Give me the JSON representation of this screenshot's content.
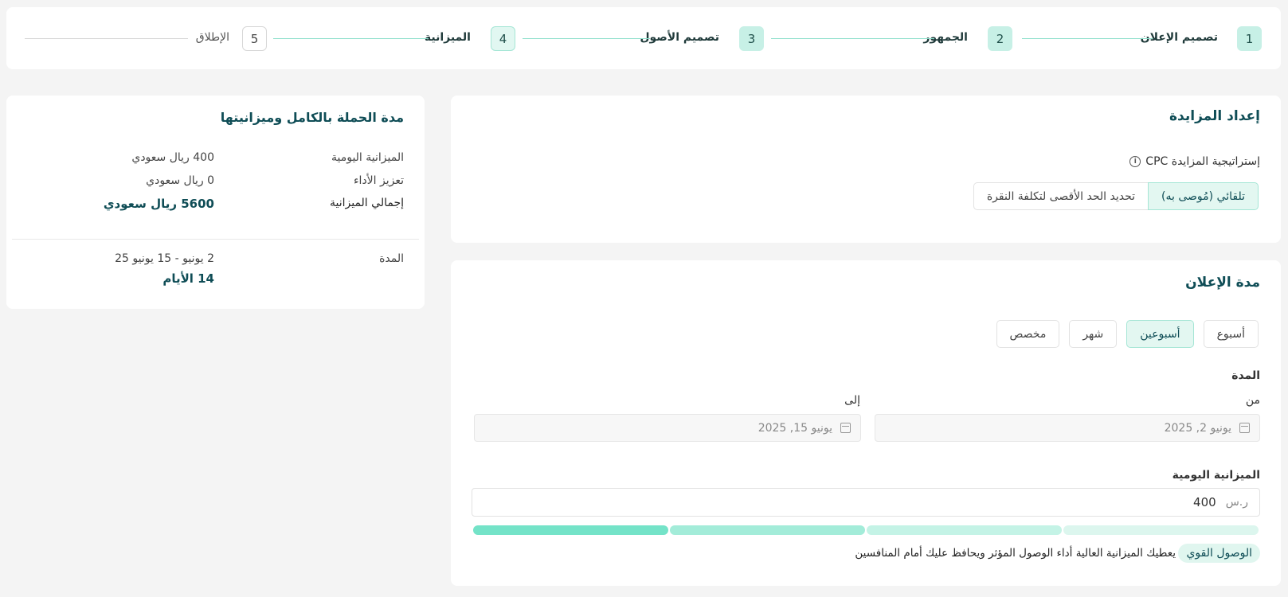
{
  "stepper": {
    "steps": [
      {
        "number": "1",
        "label": "تصميم الإعلان"
      },
      {
        "number": "2",
        "label": "الجمهور"
      },
      {
        "number": "3",
        "label": "تصميم الأصول"
      },
      {
        "number": "4",
        "label": "الميزانية"
      },
      {
        "number": "5",
        "label": "الإطلاق"
      }
    ]
  },
  "bidding": {
    "title": "إعداد المزايدة",
    "strategy_label": "إستراتيجية المزايدة CPC",
    "info_icon": "info-icon",
    "options": [
      {
        "label": "تلقائي (مُوصى به)",
        "selected": true
      },
      {
        "label": "تحديد الحد الأقصى لتكلفة النقرة",
        "selected": false
      }
    ]
  },
  "duration": {
    "title": "مدة الإعلان",
    "presets": [
      {
        "label": "أسبوع",
        "selected": false
      },
      {
        "label": "أسبوعين",
        "selected": true
      },
      {
        "label": "شهر",
        "selected": false
      },
      {
        "label": "مخصص",
        "selected": false
      }
    ],
    "period_label": "المدة",
    "from_label": "من",
    "to_label": "إلى",
    "from_value": "يونيو 2, 2025",
    "to_value": "يونيو 15, 2025",
    "daily_budget_label": "الميزانية اليومية",
    "currency_prefix": "ر.س",
    "daily_budget_value": "400",
    "reach_level": {
      "filled_segments": 1,
      "total_segments": 4
    },
    "reach_badge": "الوصول القوي",
    "reach_hint": "يعطيك الميزانية العالية أداء الوصول المؤثر ويحافظ عليك أمام المنافسين"
  },
  "summary": {
    "title": "مدة الحملة بالكامل وميزانيتها",
    "daily_budget_label": "الميزانية اليومية",
    "daily_budget_value": "400 ريال سعودي",
    "boost_label": "تعزيز الأداء",
    "boost_value": "0 ريال سعودي",
    "total_label": "إجمالي الميزانية",
    "total_value": "5600 ريال سعودي",
    "period_label": "المدة",
    "period_value": "2 يونيو - 15 يونيو 25",
    "days_value": "14 الأيام"
  },
  "colors": {
    "accent": "#0f4d56",
    "bar_strong": "#74e3c8",
    "bar_medium": "#a3ecd9",
    "bar_light": "#c4f3e6",
    "bar_faint": "#dcf6ee"
  }
}
